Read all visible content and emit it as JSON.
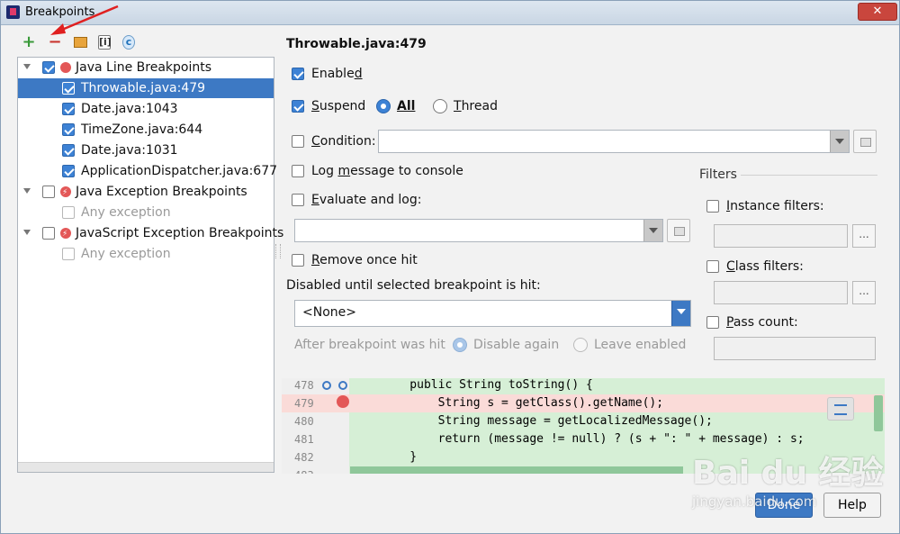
{
  "window": {
    "title": "Breakpoints",
    "close_label": "✕"
  },
  "tree": {
    "groups": [
      {
        "label": "Java Line Breakpoints",
        "checked": true,
        "items": [
          {
            "label": "Throwable.java:479",
            "checked": true,
            "selected": true
          },
          {
            "label": "Date.java:1043",
            "checked": true
          },
          {
            "label": "TimeZone.java:644",
            "checked": true
          },
          {
            "label": "Date.java:1031",
            "checked": true
          },
          {
            "label": "ApplicationDispatcher.java:677",
            "checked": true
          }
        ]
      },
      {
        "label": "Java Exception Breakpoints",
        "checked": false,
        "items": [
          {
            "label": "Any exception",
            "checked": false
          }
        ]
      },
      {
        "label": "JavaScript Exception Breakpoints",
        "checked": false,
        "items": [
          {
            "label": "Any exception",
            "checked": false
          }
        ]
      }
    ]
  },
  "detail": {
    "title": "Throwable.java:479",
    "enabled": {
      "pre": "Enable",
      "u": "d",
      "post": ""
    },
    "suspend": {
      "pre": "",
      "u": "S",
      "post": "uspend"
    },
    "suspend_all": "All",
    "suspend_thread": {
      "pre": "",
      "u": "T",
      "post": "hread"
    },
    "condition": {
      "pre": "",
      "u": "C",
      "post": "ondition:"
    },
    "log_message": {
      "pre": "Log ",
      "u": "m",
      "post": "essage to console"
    },
    "evaluate_log": {
      "pre": "",
      "u": "E",
      "post": "valuate and log:"
    },
    "remove_once_hit": {
      "pre": "",
      "u": "R",
      "post": "emove once hit"
    },
    "disabled_until": "Disabled until selected breakpoint is hit:",
    "disabled_until_value": "<None>",
    "after_hit": "After breakpoint was hit",
    "disable_again": "Disable again",
    "leave_enabled": "Leave enabled"
  },
  "filters": {
    "heading": "Filters",
    "instance": {
      "pre": "",
      "u": "I",
      "post": "nstance filters:"
    },
    "class": {
      "pre": "",
      "u": "C",
      "post": "lass filters:"
    },
    "pass_count": {
      "pre": "",
      "u": "P",
      "post": "ass count:"
    },
    "dots": "..."
  },
  "code": {
    "lines": [
      {
        "num": "478",
        "text": "    public String toString() {"
      },
      {
        "num": "479",
        "text": "        String s = getClass().getName();"
      },
      {
        "num": "480",
        "text": "        String message = getLocalizedMessage();"
      },
      {
        "num": "481",
        "text": "        return (message != null) ? (s + \": \" + message) : s;"
      },
      {
        "num": "482",
        "text": "    }"
      },
      {
        "num": "483",
        "text": ""
      }
    ]
  },
  "buttons": {
    "done": "Done",
    "help": "Help"
  },
  "watermark": {
    "brand": "Bai du 经验",
    "url": "jingyan.baidu.com"
  },
  "colors": {
    "selection": "#3d79c4",
    "breakpoint": "#e35757",
    "code_bg": "#d6efd6",
    "code_highlight": "#fadbd8"
  }
}
